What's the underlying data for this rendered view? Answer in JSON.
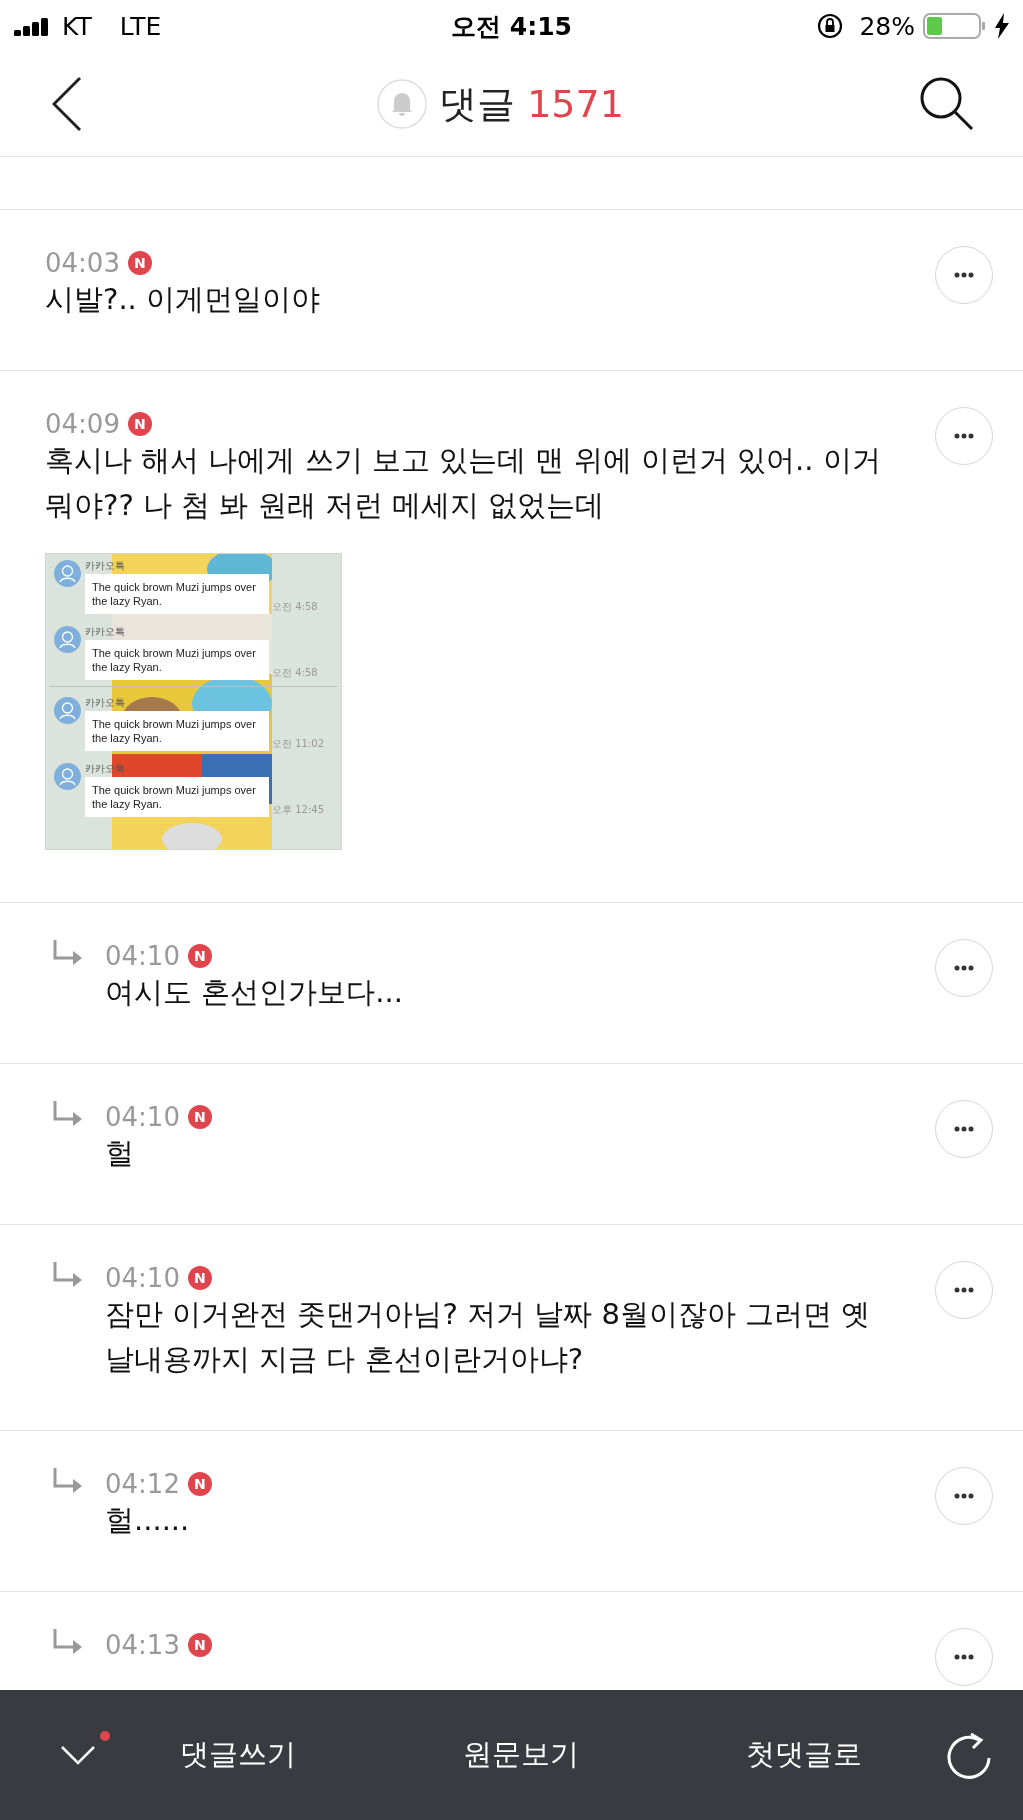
{
  "status_bar": {
    "carrier": "KT",
    "network": "LTE",
    "time": "오전 4:15",
    "battery": "28%"
  },
  "header": {
    "title": "댓글",
    "count": "1571"
  },
  "comments": [
    {
      "kind": "comment",
      "time": "04:03",
      "badge": "N",
      "text": "시발?.. 이게먼일이야"
    },
    {
      "kind": "comment",
      "time": "04:09",
      "badge": "N",
      "text": "혹시나 해서 나에게 쓰기 보고 있는데 맨 위에 이런거 있어.. 이거 뭐야?? 나 첨 봐 원래 저런 메세지 없었는데",
      "attachment": {
        "messages": [
          {
            "sender": "카카오톡",
            "text": "The quick brown Muzi jumps over the lazy Ryan.",
            "time": "오전 4:58"
          },
          {
            "sender": "카카오톡",
            "text": "The quick brown Muzi jumps over the lazy Ryan.",
            "time": "오전 4:58"
          },
          {
            "sender": "카카오톡",
            "text": "The quick brown Muzi jumps over the lazy Ryan.",
            "time": "오전 11:02"
          },
          {
            "sender": "카카오톡",
            "text": "The quick brown Muzi jumps over the lazy Ryan.",
            "time": "오후 12:45"
          }
        ]
      }
    },
    {
      "kind": "reply",
      "time": "04:10",
      "badge": "N",
      "text": "여시도 혼선인가보다..."
    },
    {
      "kind": "reply",
      "time": "04:10",
      "badge": "N",
      "text": "헐"
    },
    {
      "kind": "reply",
      "time": "04:10",
      "badge": "N",
      "text": "잠만 이거완전 좃댄거아님? 저거 날짜 8월이잖아 그러면 옛날내용까지 지금 다 혼선이란거아냐?"
    },
    {
      "kind": "reply",
      "time": "04:12",
      "badge": "N",
      "text": "헐......"
    },
    {
      "kind": "reply",
      "time": "04:13",
      "badge": "N"
    }
  ],
  "bottom_bar": {
    "notification_dot": true,
    "buttons": [
      "댓글쓰기",
      "원문보기",
      "첫댓글로"
    ]
  }
}
